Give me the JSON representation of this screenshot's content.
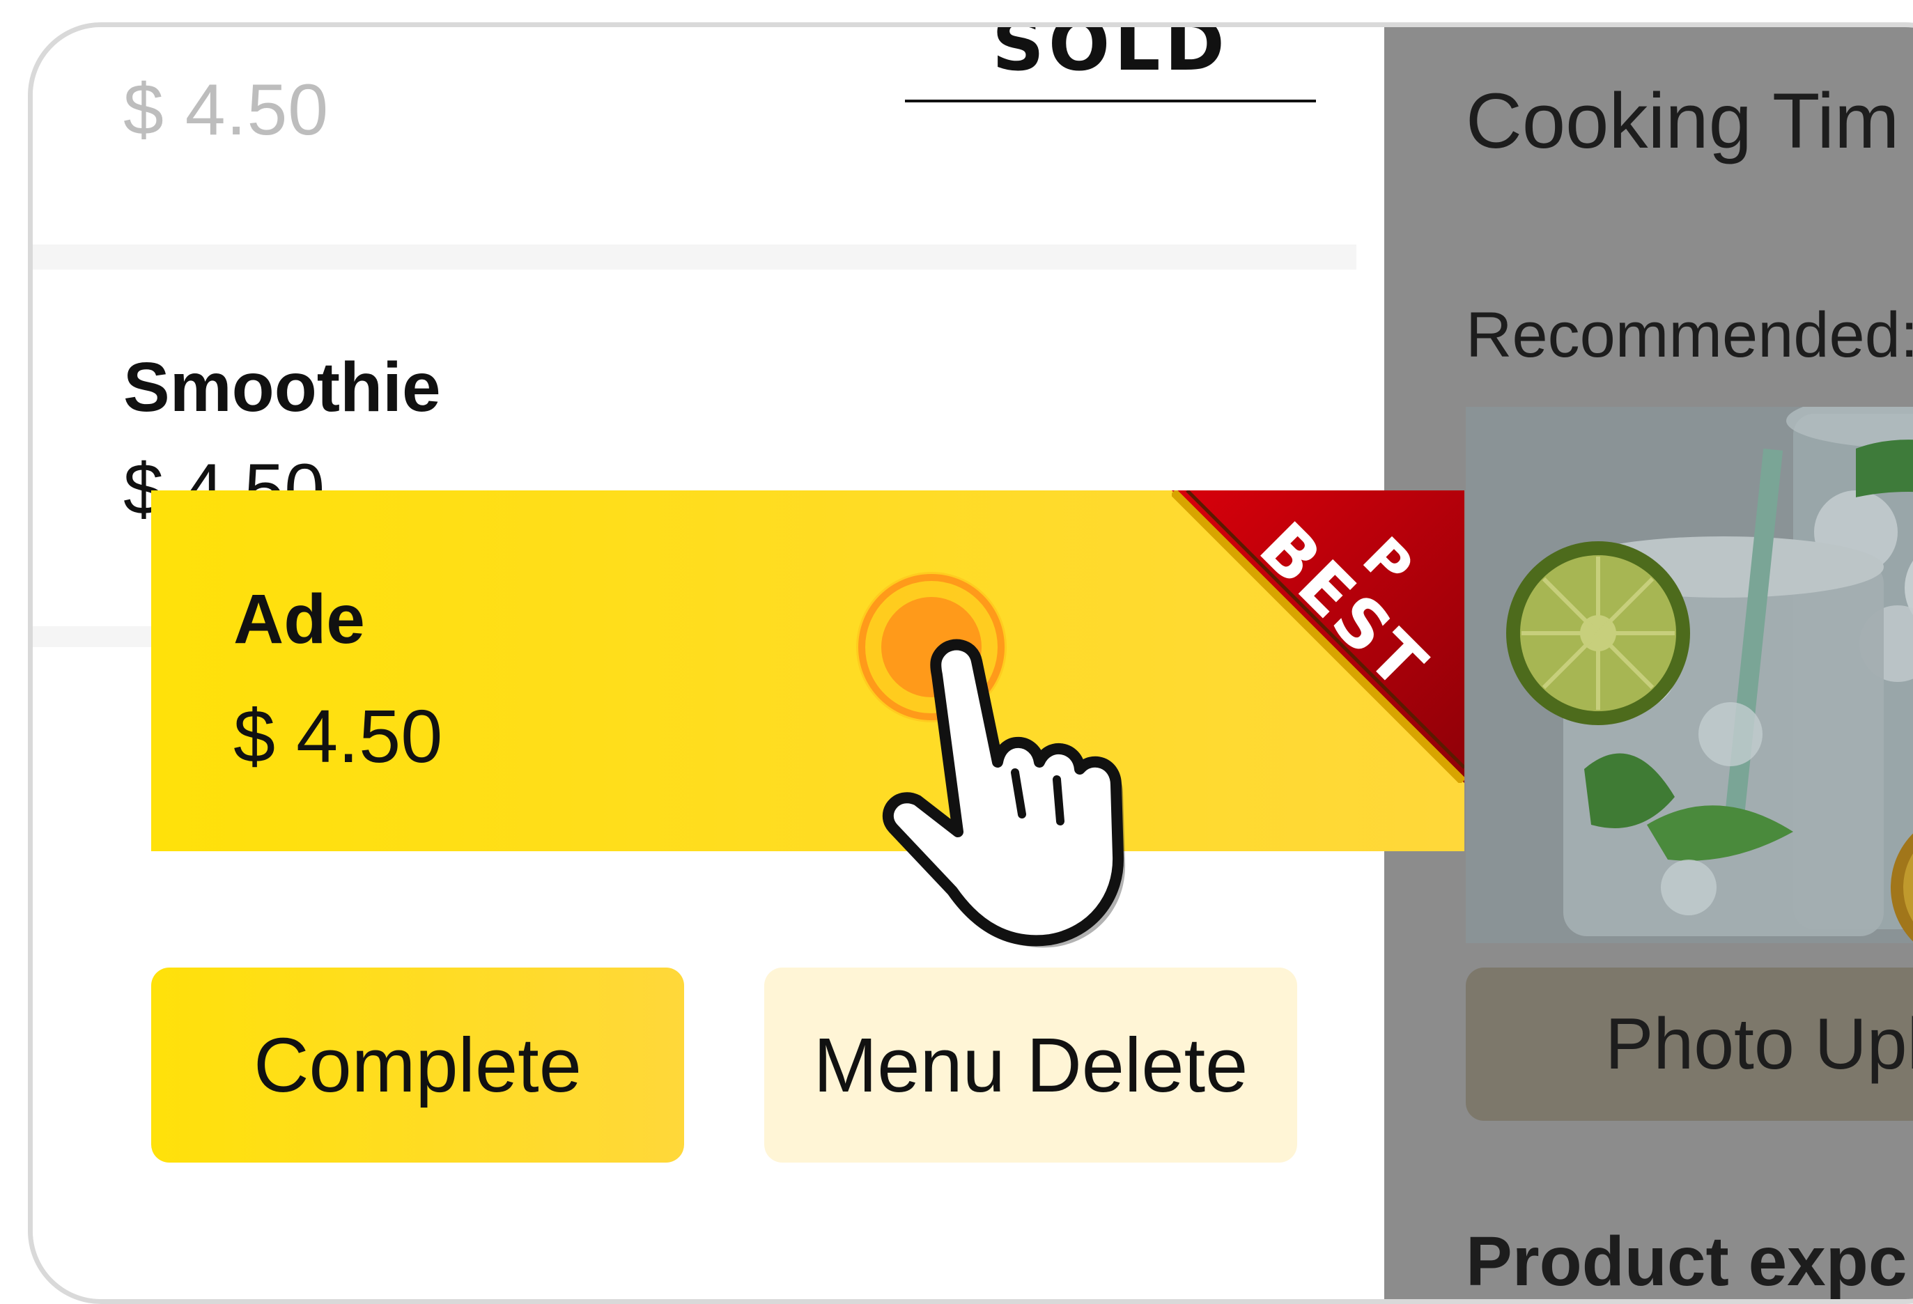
{
  "list": {
    "top_row_price": "$ 4.50",
    "sold_out_label": "SOLD OUT",
    "smoothie": {
      "name": "Smoothie",
      "price": "$ 4.50"
    },
    "ade": {
      "name": "Ade",
      "price": "$ 4.50",
      "badge": "BEST",
      "badge_prefix": "P"
    }
  },
  "actions": {
    "complete_label": "Complete",
    "delete_label": "Menu Delete"
  },
  "detail": {
    "cooking_time_label": "Cooking Tim",
    "recommended_label": "Recommended:",
    "photo_upload_label": "Photo Upl",
    "product_explanation_label": "Product expc"
  },
  "colors": {
    "accent_yellow": "#ffe10a",
    "ribbon_red": "#c4000a",
    "tap_orange": "#ff9a1a",
    "overlay_grey": "#8c8c8c"
  },
  "icons": [
    "hand-pointer-icon",
    "tap-ripple-icon",
    "best-ribbon-icon"
  ]
}
